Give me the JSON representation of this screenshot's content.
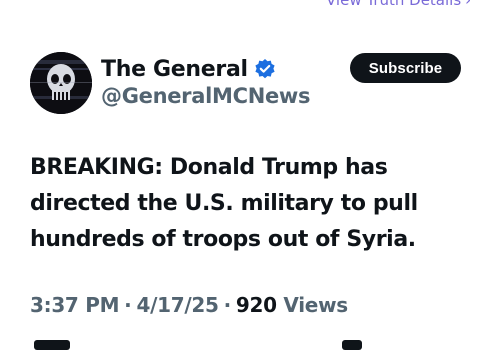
{
  "header_link": {
    "label": "View Truth Details",
    "chevron": "›"
  },
  "author": {
    "display_name": "The General",
    "handle": "@GeneralMCNews",
    "verified_icon": "verified-badge-icon",
    "avatar_icon": "skull-avatar"
  },
  "subscribe_button": {
    "label": "Subscribe"
  },
  "post": {
    "text": "BREAKING: Donald Trump has directed the U.S. military to pull hundreds of troops out of Syria."
  },
  "meta": {
    "time": "3:37 PM",
    "date": "4/17/25",
    "views_count": "920",
    "views_label": "Views",
    "separator": "·"
  },
  "colors": {
    "accent_link": "#7a6bd8",
    "verified_blue": "#1d6fe0",
    "text_primary": "#0f1419",
    "text_secondary": "#536471",
    "button_bg": "#0f1419"
  }
}
